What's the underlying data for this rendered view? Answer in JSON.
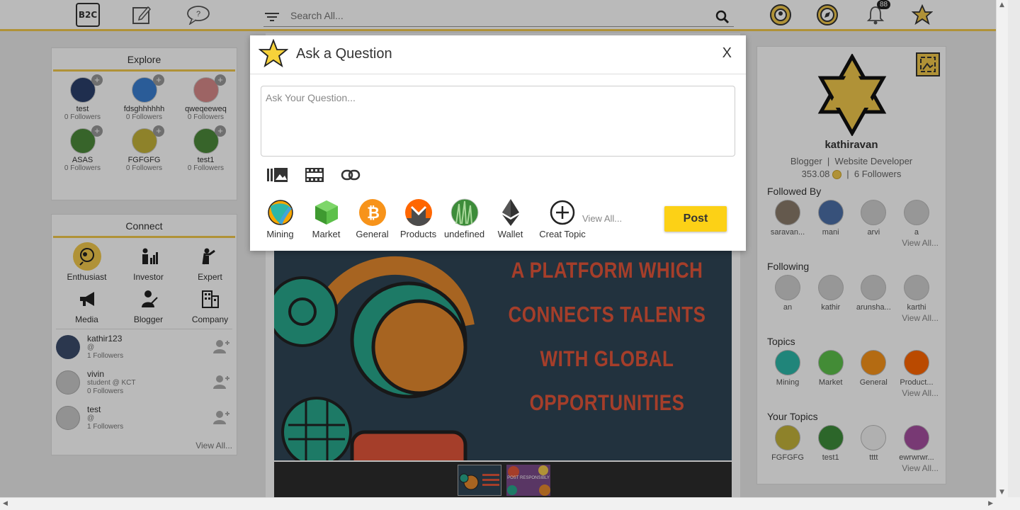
{
  "header": {
    "logo_text": "B2C",
    "search_placeholder": "Search All...",
    "notification_count": "88"
  },
  "explore": {
    "title": "Explore",
    "items": [
      {
        "name": "test",
        "followers": "0 Followers",
        "color": "#2b3f6b"
      },
      {
        "name": "fdsghhhhhh",
        "followers": "0 Followers",
        "color": "#3a7fd1"
      },
      {
        "name": "qweqeeweq",
        "followers": "0 Followers",
        "color": "#d88a8a"
      },
      {
        "name": "ASAS",
        "followers": "0 Followers",
        "color": "#4c8a3a"
      },
      {
        "name": "FGFGFG",
        "followers": "0 Followers",
        "color": "#c3b23a"
      },
      {
        "name": "test1",
        "followers": "0 Followers",
        "color": "#4c8a3a"
      }
    ]
  },
  "connect": {
    "title": "Connect",
    "roles": [
      {
        "label": "Enthusiast",
        "icon": "enthusiast-icon"
      },
      {
        "label": "Investor",
        "icon": "investor-icon"
      },
      {
        "label": "Expert",
        "icon": "expert-icon"
      },
      {
        "label": "Media",
        "icon": "megaphone-icon"
      },
      {
        "label": "Blogger",
        "icon": "blogger-icon"
      },
      {
        "label": "Company",
        "icon": "building-icon"
      }
    ],
    "users": [
      {
        "name": "kathir123",
        "sub1": "@",
        "sub2": "1 Followers"
      },
      {
        "name": "vivin",
        "sub1": "student @ KCT",
        "sub2": "0 Followers"
      },
      {
        "name": "test",
        "sub1": "@",
        "sub2": "1 Followers"
      }
    ],
    "view_all": "View All..."
  },
  "banner": {
    "line1": "A PLATFORM WHICH",
    "line2": "CONNECTS TALENTS",
    "line3": "WITH GLOBAL OPPORTUNITIES",
    "thumb2_text": "POST RESPONSIBLY"
  },
  "profile": {
    "name": "kathiravan",
    "role1": "Blogger",
    "separator": "|",
    "role2": "Website Developer",
    "points": "353.08",
    "followers": "6 Followers",
    "followed_by": {
      "title": "Followed By",
      "items": [
        "saravan...",
        "mani",
        "arvi",
        "a"
      ],
      "view_all": "View All..."
    },
    "following": {
      "title": "Following",
      "items": [
        "an",
        "kathir",
        "arunsha...",
        "karthi"
      ],
      "view_all": "View All..."
    },
    "topics": {
      "title": "Topics",
      "items": [
        "Mining",
        "Market",
        "General",
        "Product..."
      ],
      "view_all": "View All..."
    },
    "your_topics": {
      "title": "Your Topics",
      "items": [
        "FGFGFG",
        "test1",
        "tttt",
        "ewrwrwr..."
      ],
      "view_all": "View All..."
    }
  },
  "modal": {
    "title": "Ask a Question",
    "close_label": "X",
    "input_placeholder": "Ask Your Question...",
    "topics": [
      "Mining",
      "Market",
      "General",
      "Products",
      "undefined",
      "Wallet",
      "Creat Topic"
    ],
    "view_all": "View All...",
    "post_label": "Post"
  },
  "colors": {
    "accent": "#f2c94c",
    "post_button": "#fcd116",
    "banner_bg": "#2f4556",
    "banner_text": "#e2553a"
  }
}
